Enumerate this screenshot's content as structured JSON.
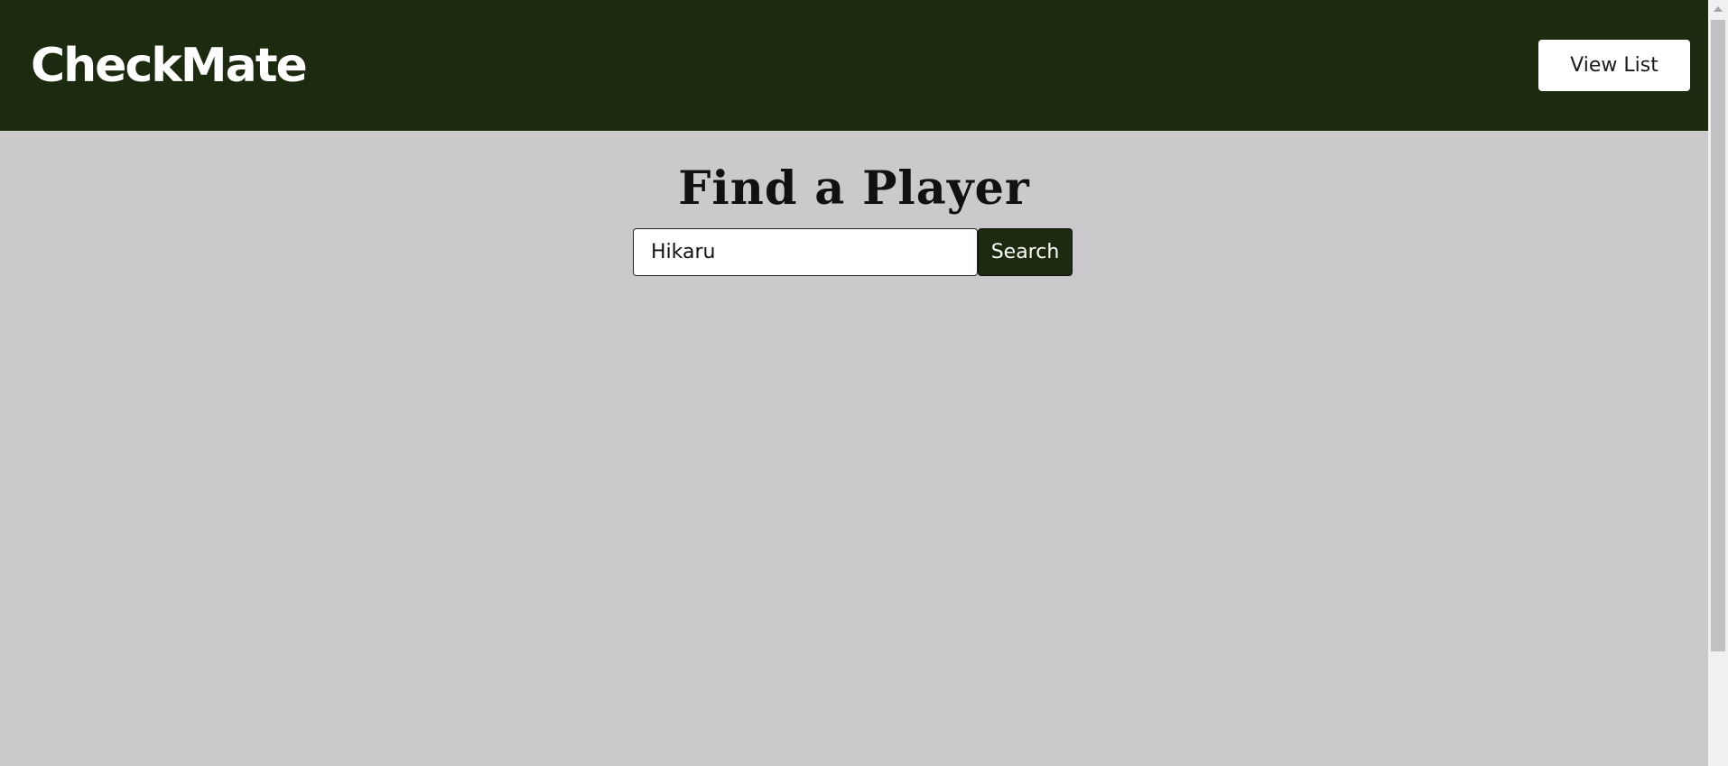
{
  "header": {
    "logo_text": "CheckMate",
    "view_list_label": "View List"
  },
  "main": {
    "title": "Find a Player",
    "search": {
      "value": "Hikaru",
      "placeholder": "",
      "button_label": "Search"
    }
  },
  "colors": {
    "header_bg": "#1c2a10",
    "page_bg": "#cbc9cb",
    "button_dark": "#1c2a10",
    "button_light": "#ffffff"
  }
}
